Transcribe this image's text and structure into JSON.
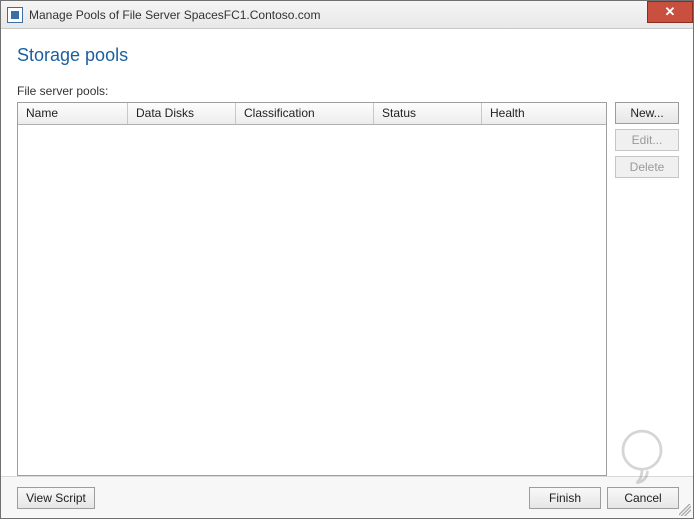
{
  "window": {
    "title": "Manage Pools of File Server SpacesFC1.Contoso.com"
  },
  "page": {
    "heading": "Storage pools",
    "pools_label": "File server pools:"
  },
  "columns": {
    "name": "Name",
    "data_disks": "Data Disks",
    "classification": "Classification",
    "status": "Status",
    "health": "Health"
  },
  "rows": [],
  "buttons": {
    "new": "New...",
    "edit": "Edit...",
    "delete": "Delete",
    "view_script": "View Script",
    "finish": "Finish",
    "cancel": "Cancel"
  }
}
